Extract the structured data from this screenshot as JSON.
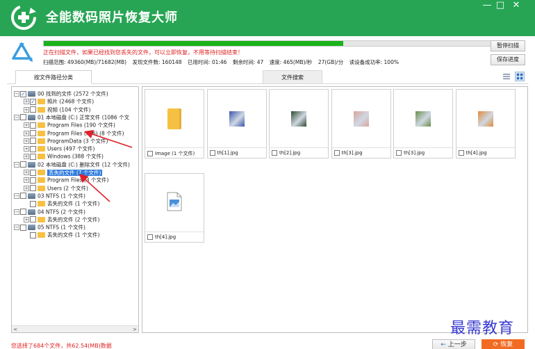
{
  "app": {
    "title": "全能数码照片恢复大师",
    "window_controls": {
      "minimize": "—",
      "maximize": "□",
      "close": "✕"
    }
  },
  "scan": {
    "progress_fraction": 0.67,
    "message": "正在扫描文件，如果已经找到您丢失的文件，可以立即恢复，不用等待扫描结束！",
    "stats": {
      "range": "扫描范围: 49360(MB)/71682(MB)",
      "found": "发现文件数: 160148",
      "elapsed": "已用时间: 01:46",
      "remaining": "剩余时间: 47",
      "speed": "速度: 465(MB)/秒",
      "total": "27(GB)/分",
      "success": "读设备成功率: 100%"
    },
    "pause_button": "暂停扫描",
    "save_button": "保存进度"
  },
  "tabs": {
    "by_path": "按文件路径分类",
    "search": "文件搜索"
  },
  "tree": [
    {
      "label": "00 找到的文件 (2572 个文件)",
      "level": 0,
      "kind": "drive",
      "checked": true,
      "expander": "−"
    },
    {
      "label": "照片    (2468 个文件)",
      "level": 1,
      "kind": "folder",
      "checked": true,
      "expander": "+"
    },
    {
      "label": "视频    (104 个文件)",
      "level": 1,
      "kind": "folder",
      "checked": false,
      "expander": "+"
    },
    {
      "label": "01 本地磁盘 (C:) 正常文件 (1086 个文",
      "level": 0,
      "kind": "drive",
      "checked": false,
      "expander": "−"
    },
    {
      "label": "Program Files     (190 个文件)",
      "level": 1,
      "kind": "folder",
      "checked": false,
      "expander": "+"
    },
    {
      "label": "Program Files (x86)     (8 个文件)",
      "level": 1,
      "kind": "folder",
      "checked": false,
      "expander": "+"
    },
    {
      "label": "ProgramData    (3 个文件)",
      "level": 1,
      "kind": "folder",
      "checked": false,
      "expander": "+"
    },
    {
      "label": "Users    (497 个文件)",
      "level": 1,
      "kind": "folder",
      "checked": false,
      "expander": "+"
    },
    {
      "label": "Windows    (388 个文件)",
      "level": 1,
      "kind": "folder",
      "checked": false,
      "expander": "+"
    },
    {
      "label": "02 本地磁盘 (C:) 删除文件 (12 个文件)",
      "level": 0,
      "kind": "drive",
      "checked": false,
      "expander": "−"
    },
    {
      "label": "丢失的文件    (7 个文件)",
      "level": 1,
      "kind": "folder",
      "checked": false,
      "expander": "+",
      "selected": true
    },
    {
      "label": "Program Files    (3 个文件)",
      "level": 1,
      "kind": "folder",
      "checked": false,
      "expander": "+"
    },
    {
      "label": "Users    (2 个文件)",
      "level": 1,
      "kind": "folder",
      "checked": false,
      "expander": "+"
    },
    {
      "label": "03  NTFS  (1 个文件)",
      "level": 0,
      "kind": "drive",
      "checked": false,
      "expander": "−"
    },
    {
      "label": "丢失的文件    (1 个文件)",
      "level": 1,
      "kind": "folder",
      "checked": false,
      "expander": ""
    },
    {
      "label": "04  NTFS  (2 个文件)",
      "level": 0,
      "kind": "drive",
      "checked": false,
      "expander": "−"
    },
    {
      "label": "丢失的文件    (2 个文件)",
      "level": 1,
      "kind": "folder",
      "checked": false,
      "expander": "+"
    },
    {
      "label": "05  NTFS  (1 个文件)",
      "level": 0,
      "kind": "drive",
      "checked": false,
      "expander": "−"
    },
    {
      "label": "丢失的文件    (1 个文件)",
      "level": 1,
      "kind": "folder",
      "checked": false,
      "expander": ""
    }
  ],
  "thumbnails": [
    {
      "caption": "Image  (1 个文件)",
      "kind": "folder",
      "color": "#f6c142"
    },
    {
      "caption": "th[1].jpg",
      "kind": "photo",
      "color": "#3a55a8"
    },
    {
      "caption": "th[2].jpg",
      "kind": "photo",
      "color": "#2e4a2e"
    },
    {
      "caption": "th[3].jpg",
      "kind": "photo",
      "color": "#d9a59a"
    },
    {
      "caption": "th[3].jpg",
      "kind": "photo",
      "color": "#6b8f4a"
    },
    {
      "caption": "th[4].jpg",
      "kind": "photo",
      "color": "#e08a3c"
    },
    {
      "caption": "th[4].jpg",
      "kind": "image-file",
      "color": "#4a90d9"
    }
  ],
  "footer": {
    "status": "您选择了684个文件，共62.54(MB)数据",
    "prev_button": "上一步",
    "recover_button": "恢复",
    "watermark": "最需教育"
  },
  "colors": {
    "titlebar": "#27a554",
    "progress": "#1bb21b",
    "alert_text": "#e02020",
    "recover_button": "#f26b22",
    "annotation_arrow": "#e0202a"
  }
}
